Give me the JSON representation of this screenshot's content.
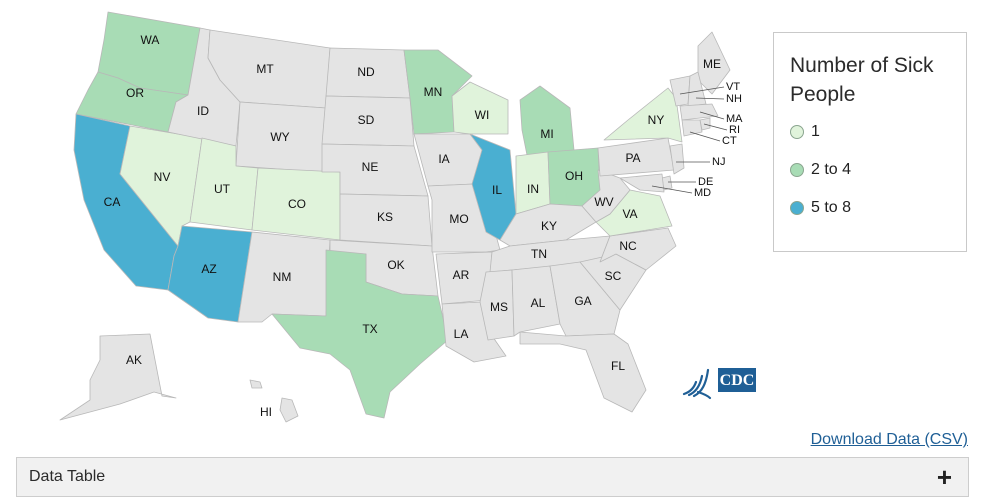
{
  "legend": {
    "title": "Number of Sick People",
    "items": [
      {
        "label": "1",
        "color": "#e0f3db"
      },
      {
        "label": "2 to 4",
        "color": "#a8dcb5"
      },
      {
        "label": "5 to 8",
        "color": "#4aafd1"
      }
    ]
  },
  "no_data_color": "#e4e4e4",
  "states": {
    "WA": {
      "category": "2 to 4"
    },
    "OR": {
      "category": "2 to 4"
    },
    "CA": {
      "category": "5 to 8"
    },
    "NV": {
      "category": "1"
    },
    "ID": {
      "category": null
    },
    "MT": {
      "category": null
    },
    "WY": {
      "category": null
    },
    "UT": {
      "category": "1"
    },
    "CO": {
      "category": "1"
    },
    "AZ": {
      "category": "5 to 8"
    },
    "NM": {
      "category": null
    },
    "ND": {
      "category": null
    },
    "SD": {
      "category": null
    },
    "NE": {
      "category": null
    },
    "KS": {
      "category": null
    },
    "OK": {
      "category": null
    },
    "TX": {
      "category": "2 to 4"
    },
    "MN": {
      "category": "2 to 4"
    },
    "IA": {
      "category": null
    },
    "MO": {
      "category": null
    },
    "AR": {
      "category": null
    },
    "LA": {
      "category": null
    },
    "WI": {
      "category": "1"
    },
    "IL": {
      "category": "5 to 8"
    },
    "MI": {
      "category": "2 to 4"
    },
    "IN": {
      "category": "1"
    },
    "OH": {
      "category": "2 to 4"
    },
    "KY": {
      "category": null
    },
    "TN": {
      "category": null
    },
    "MS": {
      "category": null
    },
    "AL": {
      "category": null
    },
    "GA": {
      "category": null
    },
    "FL": {
      "category": null
    },
    "SC": {
      "category": null
    },
    "NC": {
      "category": null
    },
    "VA": {
      "category": "1"
    },
    "WV": {
      "category": null
    },
    "PA": {
      "category": null
    },
    "NY": {
      "category": "1"
    },
    "ME": {
      "category": null
    },
    "VT": {
      "category": null
    },
    "NH": {
      "category": null
    },
    "MA": {
      "category": null
    },
    "RI": {
      "category": null
    },
    "CT": {
      "category": null
    },
    "NJ": {
      "category": null
    },
    "DE": {
      "category": null
    },
    "MD": {
      "category": null
    },
    "AK": {
      "category": null
    },
    "HI": {
      "category": null
    }
  },
  "logo": {
    "name": "CDC",
    "text": "CDC"
  },
  "download_label": "Download Data (CSV)",
  "data_table": {
    "label": "Data Table",
    "toggle": "+"
  }
}
